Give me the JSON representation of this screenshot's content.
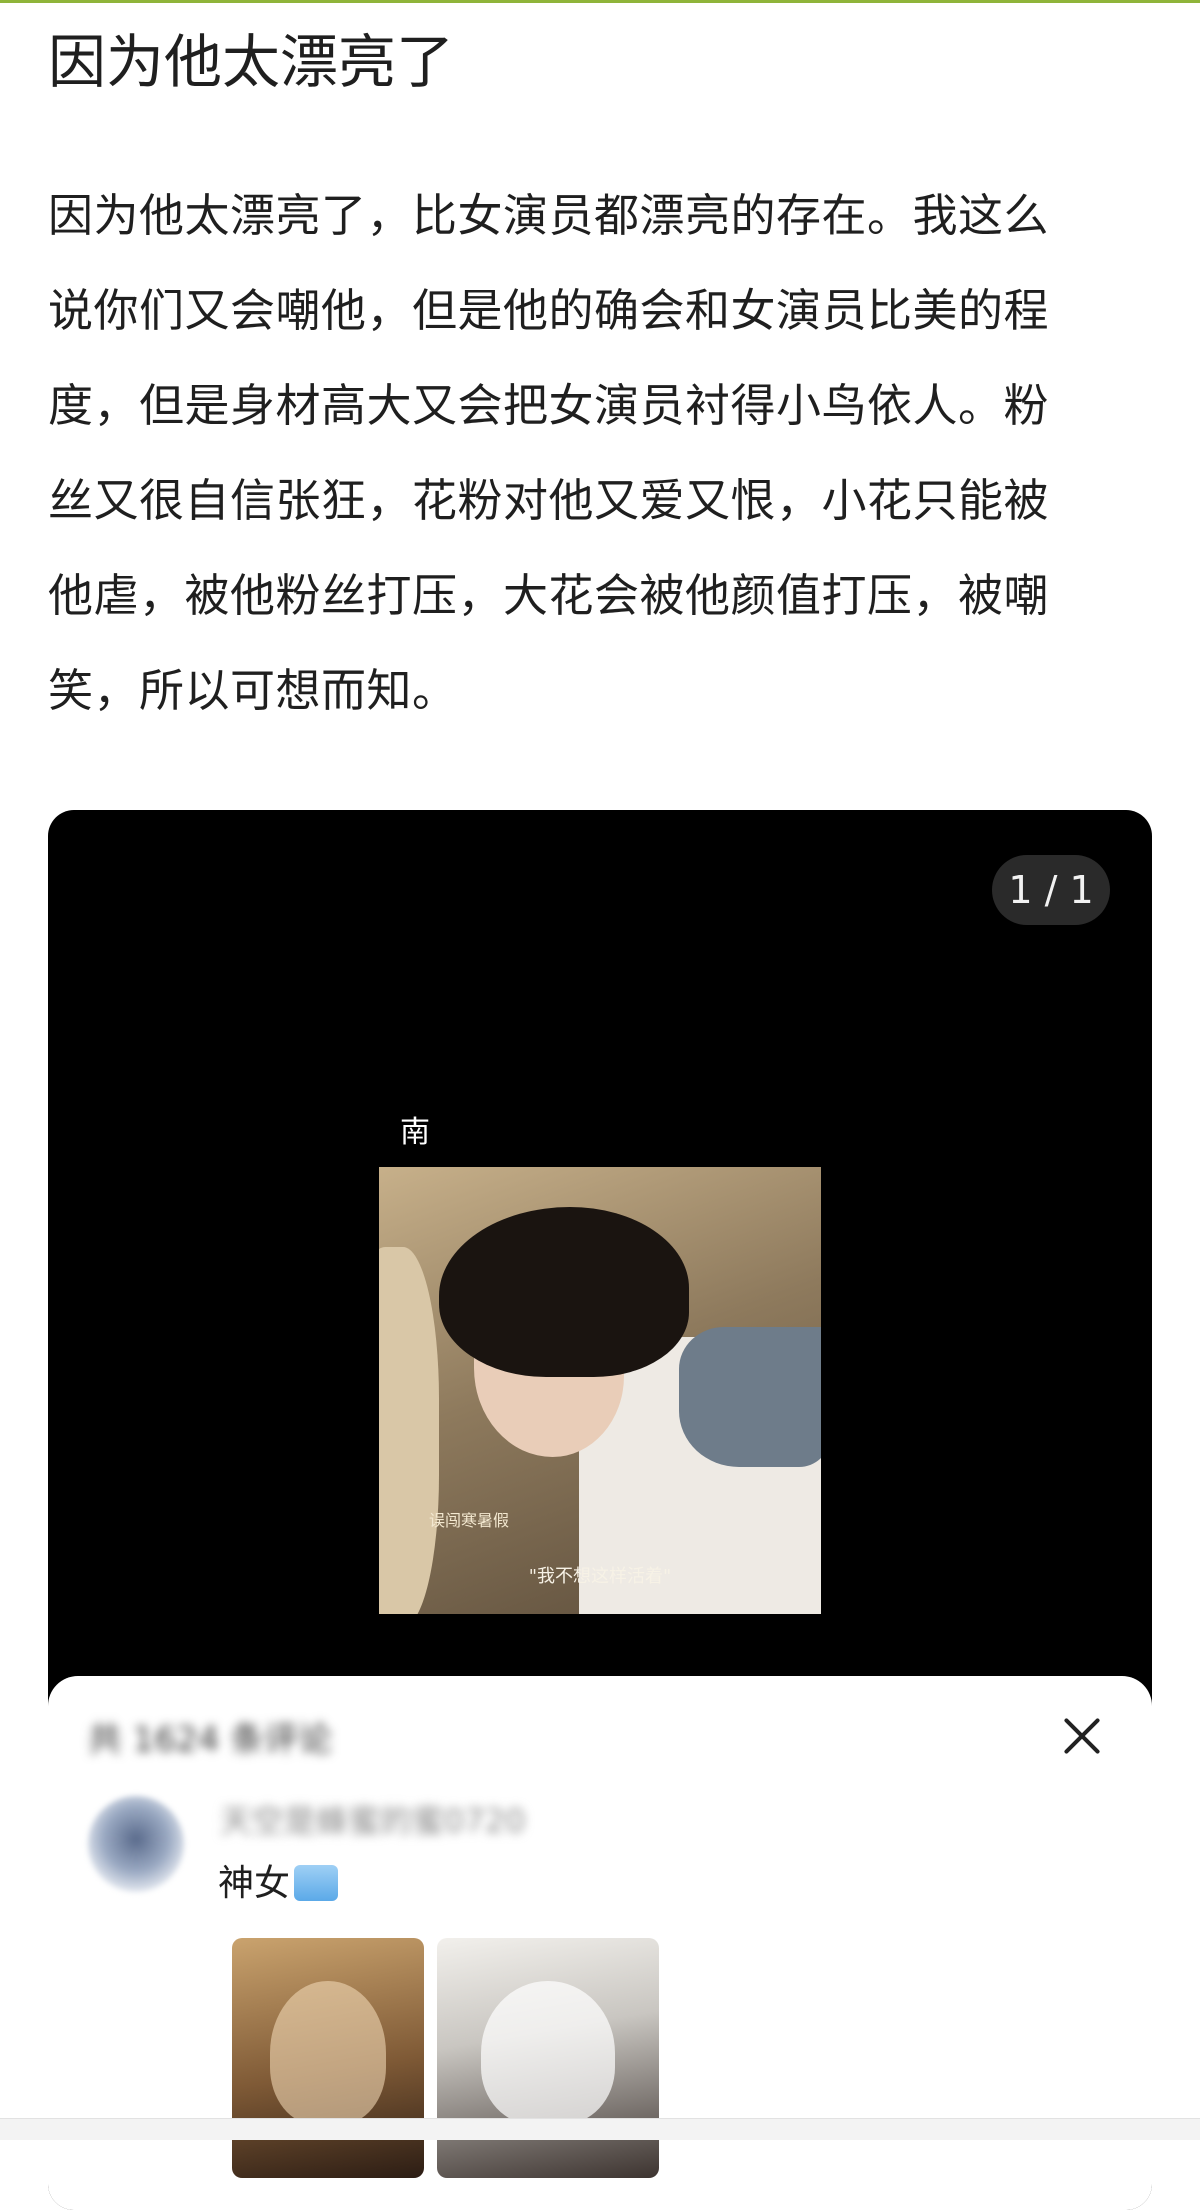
{
  "post": {
    "title": "因为他太漂亮了",
    "body_lines": [
      "因为他太漂亮了，比女演员都漂亮的存在。我这么",
      "说你们又会嘲他，但是他的确会和女演员比美的程",
      "度，但是身材高大又会把女演员衬得小鸟依人。粉",
      "丝又很自信张狂，花粉对他又爱又恨，小花只能被",
      "他虐，被他粉丝打压，大花会被他颜值打压，被嘲",
      "笑，所以可想而知。"
    ]
  },
  "media": {
    "counter": "1 / 1",
    "show_logo": "南",
    "subtitle_tag": "误闯寒暑假",
    "subtitle_quote": "\"我不想这样活着\""
  },
  "comments": {
    "header": "共 1624 条评论",
    "items": [
      {
        "username": "天空是蜂蜜的蜜0720",
        "text": "神女",
        "emoji": "crying-emoji"
      }
    ]
  },
  "colors": {
    "accent": "#8fb43a",
    "media_bg": "#000000",
    "counter_bg": "#2a2a2a"
  }
}
